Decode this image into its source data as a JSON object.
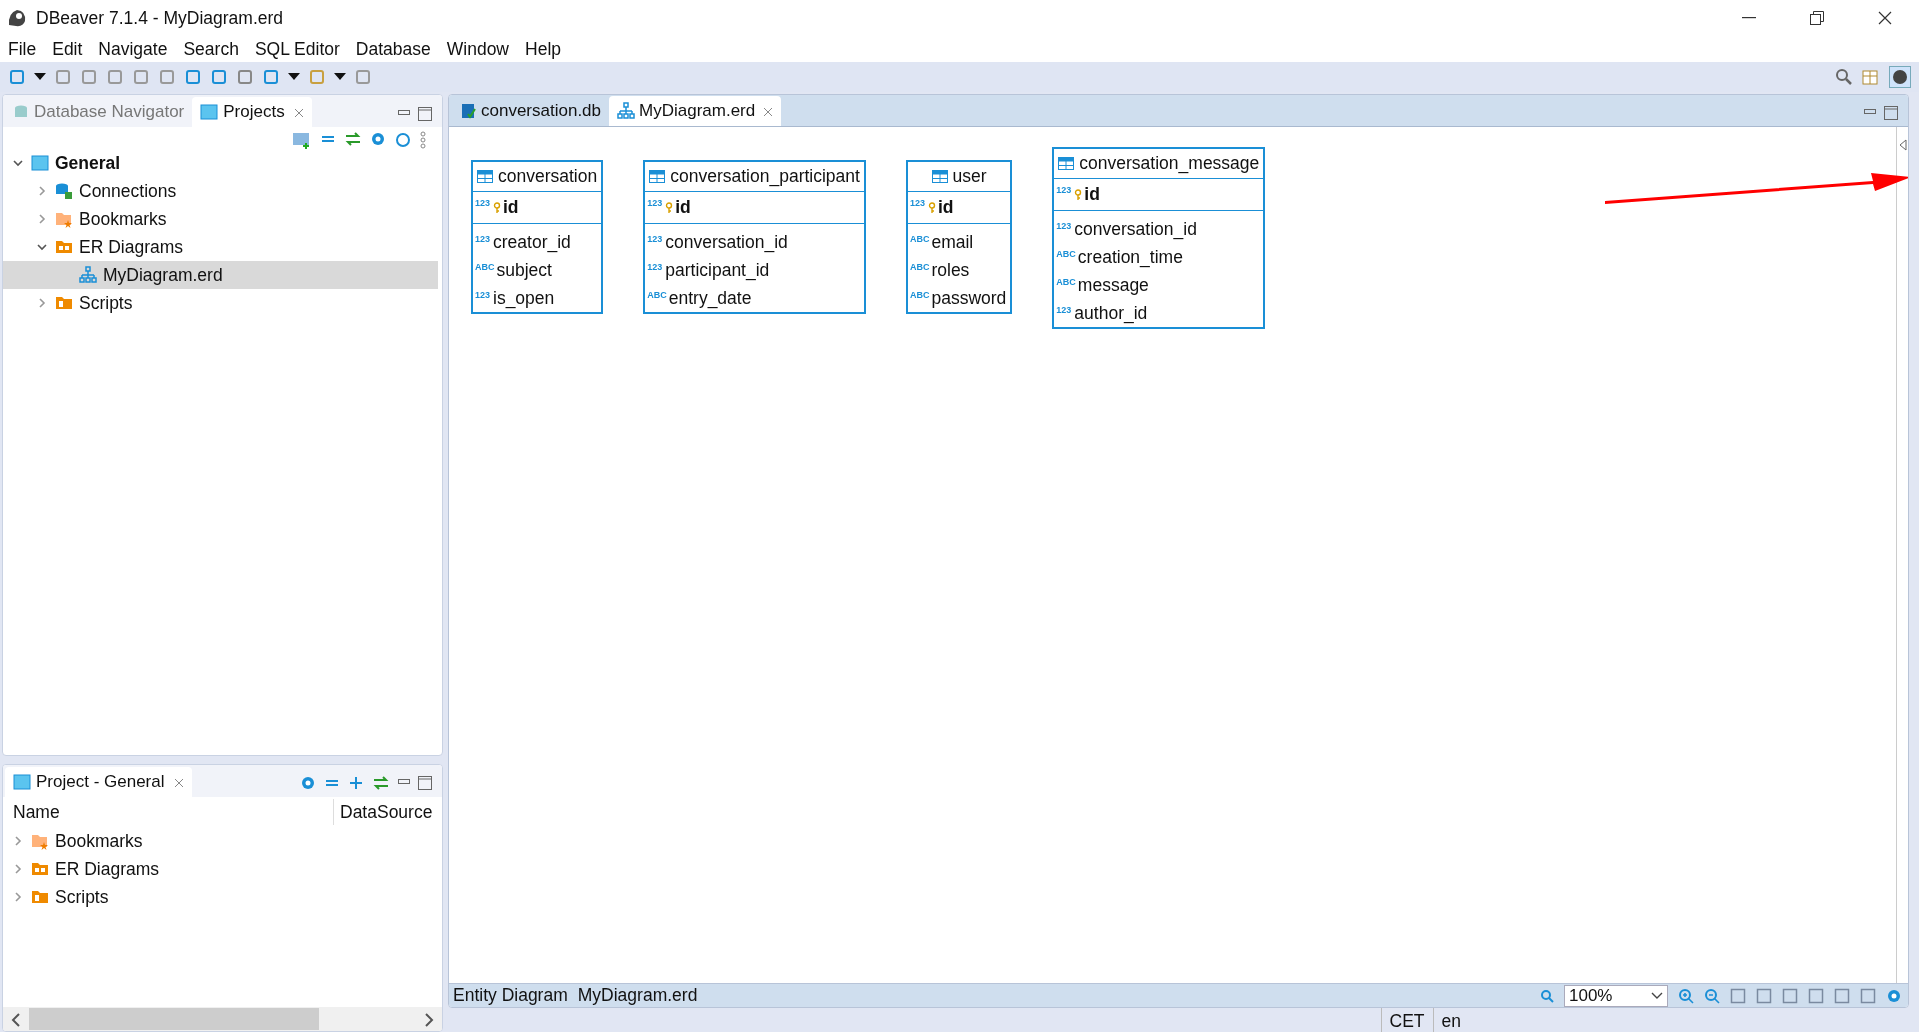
{
  "window": {
    "title": "DBeaver 7.1.4 - MyDiagram.erd"
  },
  "menu": [
    "File",
    "Edit",
    "Navigate",
    "Search",
    "SQL Editor",
    "Database",
    "Window",
    "Help"
  ],
  "left_tabs": [
    {
      "label": "Database Navigator",
      "selected": false
    },
    {
      "label": "Projects",
      "selected": true
    }
  ],
  "tree": [
    {
      "label": "General",
      "kind": "project",
      "expanded": true,
      "selected": false,
      "children": [
        {
          "label": "Connections",
          "kind": "connections",
          "expanded": false,
          "selected": false
        },
        {
          "label": "Bookmarks",
          "kind": "bookmarks",
          "expanded": false,
          "selected": false
        },
        {
          "label": "ER Diagrams",
          "kind": "diagrams",
          "expanded": true,
          "selected": false,
          "children": [
            {
              "label": "MyDiagram.erd",
              "kind": "diagram",
              "selected": true
            }
          ]
        },
        {
          "label": "Scripts",
          "kind": "scripts",
          "expanded": false,
          "selected": false
        }
      ]
    }
  ],
  "editor_tabs": [
    {
      "label": "conversation.db",
      "kind": "database",
      "selected": false
    },
    {
      "label": "MyDiagram.erd",
      "kind": "diagram",
      "selected": true
    }
  ],
  "entities": [
    {
      "name": "conversation",
      "columns": [
        {
          "name": "id",
          "type": "123",
          "key": true
        },
        {
          "name": "creator_id",
          "type": "123",
          "key": false
        },
        {
          "name": "subject",
          "type": "ABC",
          "key": false
        },
        {
          "name": "is_open",
          "type": "123",
          "key": false
        }
      ]
    },
    {
      "name": "conversation_participant",
      "columns": [
        {
          "name": "id",
          "type": "123",
          "key": true
        },
        {
          "name": "conversation_id",
          "type": "123",
          "key": false
        },
        {
          "name": "participant_id",
          "type": "123",
          "key": false
        },
        {
          "name": "entry_date",
          "type": "ABC",
          "key": false
        }
      ]
    },
    {
      "name": "user",
      "columns": [
        {
          "name": "id",
          "type": "123",
          "key": true
        },
        {
          "name": "email",
          "type": "ABC",
          "key": false
        },
        {
          "name": "roles",
          "type": "ABC",
          "key": false
        },
        {
          "name": "password",
          "type": "ABC",
          "key": false
        }
      ]
    },
    {
      "name": "conversation_message",
      "columns": [
        {
          "name": "id",
          "type": "123",
          "key": true
        },
        {
          "name": "conversation_id",
          "type": "123",
          "key": false
        },
        {
          "name": "creation_time",
          "type": "ABC",
          "key": false
        },
        {
          "name": "message",
          "type": "ABC",
          "key": false
        },
        {
          "name": "author_id",
          "type": "123",
          "key": false
        }
      ]
    }
  ],
  "editor_status": {
    "label": "Entity Diagram",
    "file": "MyDiagram.erd",
    "zoom": "100%"
  },
  "project_panel": {
    "title": "Project - General",
    "columns": [
      "Name",
      "DataSource"
    ],
    "rows": [
      {
        "label": "Bookmarks",
        "kind": "bookmarks"
      },
      {
        "label": "ER Diagrams",
        "kind": "diagrams"
      },
      {
        "label": "Scripts",
        "kind": "scripts"
      }
    ]
  },
  "status_bar": [
    "CET",
    "en"
  ]
}
